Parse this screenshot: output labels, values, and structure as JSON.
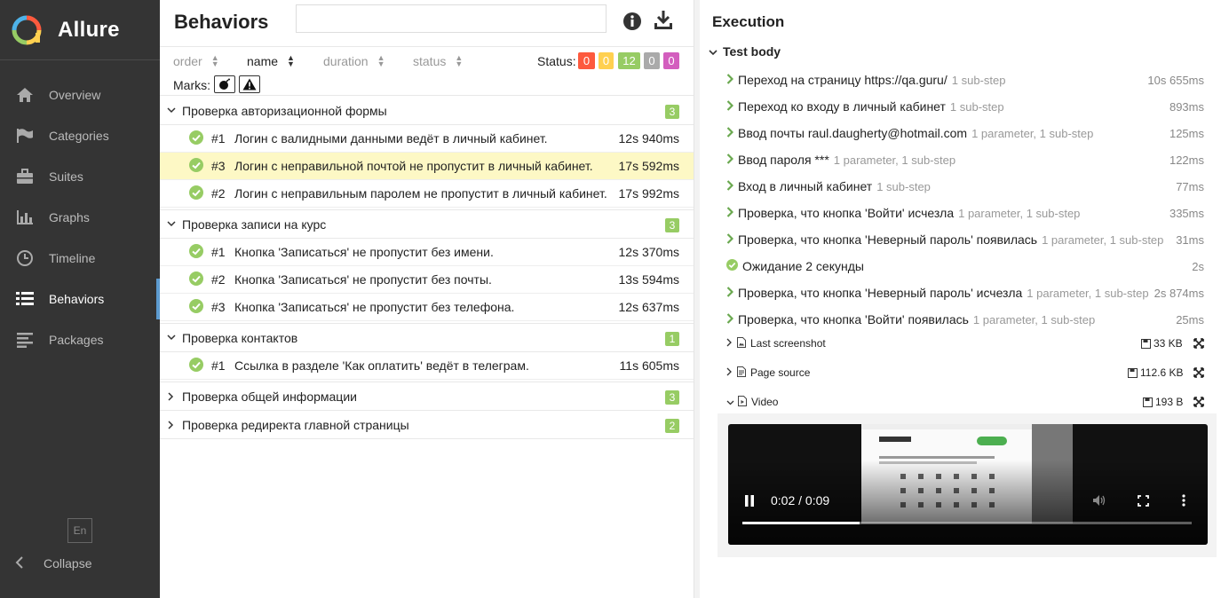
{
  "app": {
    "name": "Allure",
    "lang": "En",
    "collapse_label": "Collapse",
    "nav": [
      {
        "label": "Overview",
        "icon": "home-icon"
      },
      {
        "label": "Categories",
        "icon": "flag-icon"
      },
      {
        "label": "Suites",
        "icon": "briefcase-icon"
      },
      {
        "label": "Graphs",
        "icon": "bar-chart-icon"
      },
      {
        "label": "Timeline",
        "icon": "clock-icon"
      },
      {
        "label": "Behaviors",
        "icon": "list-icon",
        "active": true
      },
      {
        "label": "Packages",
        "icon": "align-left-icon"
      }
    ]
  },
  "behaviors": {
    "title": "Behaviors",
    "search_value": "",
    "sort": {
      "order": "order",
      "name": "name",
      "duration": "duration",
      "status": "status"
    },
    "status_label": "Status:",
    "status_counts": [
      {
        "value": "0",
        "color": "#fd5a3e"
      },
      {
        "value": "0",
        "color": "#ffd050"
      },
      {
        "value": "12",
        "color": "#97cc64"
      },
      {
        "value": "0",
        "color": "#aaaaaa"
      },
      {
        "value": "0",
        "color": "#d35ebe"
      }
    ],
    "marks_label": "Marks:",
    "groups": [
      {
        "name": "Проверка авторизационной формы",
        "count": "3",
        "expanded": true,
        "tests": [
          {
            "num": "#1",
            "name": "Логин с валидными данными ведёт в личный кабинет.",
            "duration": "12s 940ms"
          },
          {
            "num": "#3",
            "name": "Логин с неправильной почтой не пропустит в личный кабинет.",
            "duration": "17s 592ms",
            "selected": true
          },
          {
            "num": "#2",
            "name": "Логин с неправильным паролем не пропустит в личный кабинет.",
            "duration": "17s 992ms"
          }
        ]
      },
      {
        "name": "Проверка записи на курс",
        "count": "3",
        "expanded": true,
        "tests": [
          {
            "num": "#1",
            "name": "Кнопка 'Записаться' не пропустит без имени.",
            "duration": "12s 370ms"
          },
          {
            "num": "#2",
            "name": "Кнопка 'Записаться' не пропустит без почты.",
            "duration": "13s 594ms"
          },
          {
            "num": "#3",
            "name": "Кнопка 'Записаться' не пропустит без телефона.",
            "duration": "12s 637ms"
          }
        ]
      },
      {
        "name": "Проверка контактов",
        "count": "1",
        "expanded": true,
        "tests": [
          {
            "num": "#1",
            "name": "Ссылка в разделе 'Как оплатить' ведёт в телеграм.",
            "duration": "11s 605ms"
          }
        ]
      },
      {
        "name": "Проверка общей информации",
        "count": "3",
        "expanded": false,
        "tests": []
      },
      {
        "name": "Проверка редиректа главной страницы",
        "count": "2",
        "expanded": false,
        "tests": []
      }
    ]
  },
  "execution": {
    "title": "Execution",
    "test_body": "Test body",
    "steps": [
      {
        "name": "Переход на страницу https://qa.guru/",
        "meta": "1 sub-step",
        "duration": "10s 655ms"
      },
      {
        "name": "Переход ко входу в личный кабинет",
        "meta": "1 sub-step",
        "duration": "893ms"
      },
      {
        "name": "Ввод почты raul.daugherty@hotmail.com",
        "meta": "1 parameter, 1 sub-step",
        "duration": "125ms"
      },
      {
        "name": "Ввод пароля ***",
        "meta": "1 parameter, 1 sub-step",
        "duration": "122ms"
      },
      {
        "name": "Вход в личный кабинет",
        "meta": "1 sub-step",
        "duration": "77ms"
      },
      {
        "name": "Проверка, что кнопка 'Войти' исчезла",
        "meta": "1 parameter, 1 sub-step",
        "duration": "335ms"
      },
      {
        "name": "Проверка, что кнопка 'Неверный пароль' появилась",
        "meta": "1 parameter, 1 sub-step",
        "duration": "31ms"
      },
      {
        "name": "Ожидание 2 секунды",
        "meta": "",
        "duration": "2s",
        "leaf": true
      },
      {
        "name": "Проверка, что кнопка 'Неверный пароль' исчезла",
        "meta": "1 parameter, 1 sub-step",
        "duration": "2s 874ms"
      },
      {
        "name": "Проверка, что кнопка 'Войти' появилась",
        "meta": "1 parameter, 1 sub-step",
        "duration": "25ms"
      }
    ],
    "attachments": [
      {
        "name": "Last screenshot",
        "size": "33 KB",
        "type": "image",
        "expanded": false
      },
      {
        "name": "Page source",
        "size": "112.6 KB",
        "type": "document",
        "expanded": false
      },
      {
        "name": "Video",
        "size": "193 B",
        "type": "video",
        "expanded": true
      }
    ],
    "video": {
      "time": "0:02 / 0:09",
      "progress": 0.26
    }
  }
}
